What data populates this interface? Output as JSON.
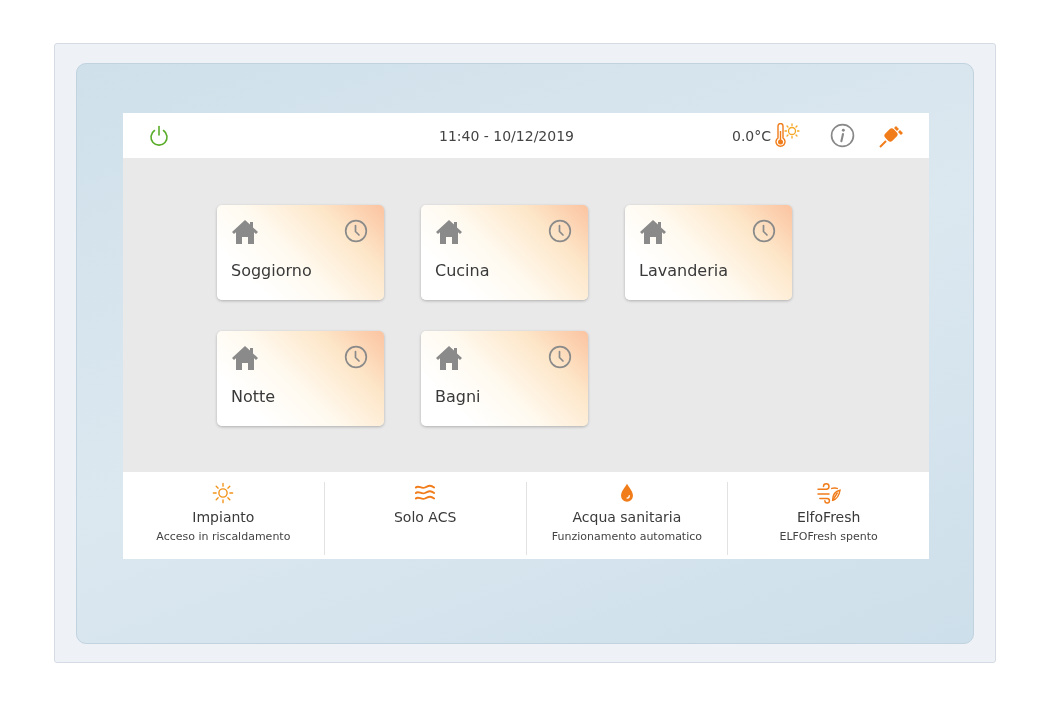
{
  "status_bar": {
    "datetime": "11:40 - 10/12/2019",
    "temperature": "0.0°C"
  },
  "rooms": [
    {
      "name": "Soggiorno"
    },
    {
      "name": "Cucina"
    },
    {
      "name": "Lavanderia"
    },
    {
      "name": "Notte"
    },
    {
      "name": "Bagni"
    }
  ],
  "modes": [
    {
      "kind": "sun",
      "title": "Impianto",
      "subtitle": "Acceso in riscaldamento"
    },
    {
      "kind": "waves",
      "title": "Solo ACS"
    },
    {
      "kind": "drop",
      "title": "Acqua sanitaria",
      "subtitle": "Funzionamento automatico"
    },
    {
      "kind": "fan",
      "title": "ElfoFresh",
      "subtitle": "ELFOFresh spento"
    }
  ]
}
